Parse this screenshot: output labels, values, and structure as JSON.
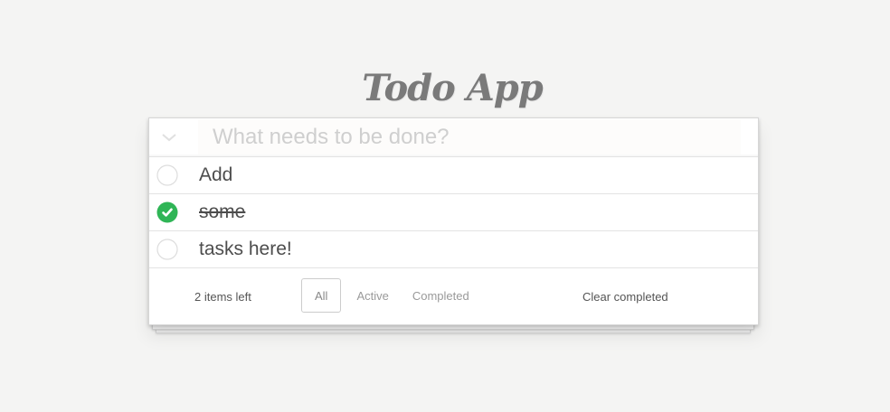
{
  "app": {
    "title": "Todo App"
  },
  "new_todo": {
    "placeholder": "What needs to be done?",
    "value": ""
  },
  "todos": [
    {
      "label": "Add",
      "completed": false
    },
    {
      "label": "some",
      "completed": true
    },
    {
      "label": "tasks here!",
      "completed": false
    }
  ],
  "footer": {
    "items_left": "2 items left",
    "filters": [
      {
        "label": "All",
        "selected": true
      },
      {
        "label": "Active",
        "selected": false
      },
      {
        "label": "Completed",
        "selected": false
      }
    ],
    "clear_completed": "Clear completed"
  },
  "icons": {
    "toggle_all": "chevron-down-icon",
    "unchecked": "empty-circle-icon",
    "checked": "green-checkmark-circle-icon"
  },
  "colors": {
    "background": "#f4f4f3",
    "title": "#7a7a7a",
    "text": "#4d4d4d",
    "placeholder": "#cfcfcf",
    "check_green": "#2fb556",
    "circle_border": "#dddddd"
  }
}
